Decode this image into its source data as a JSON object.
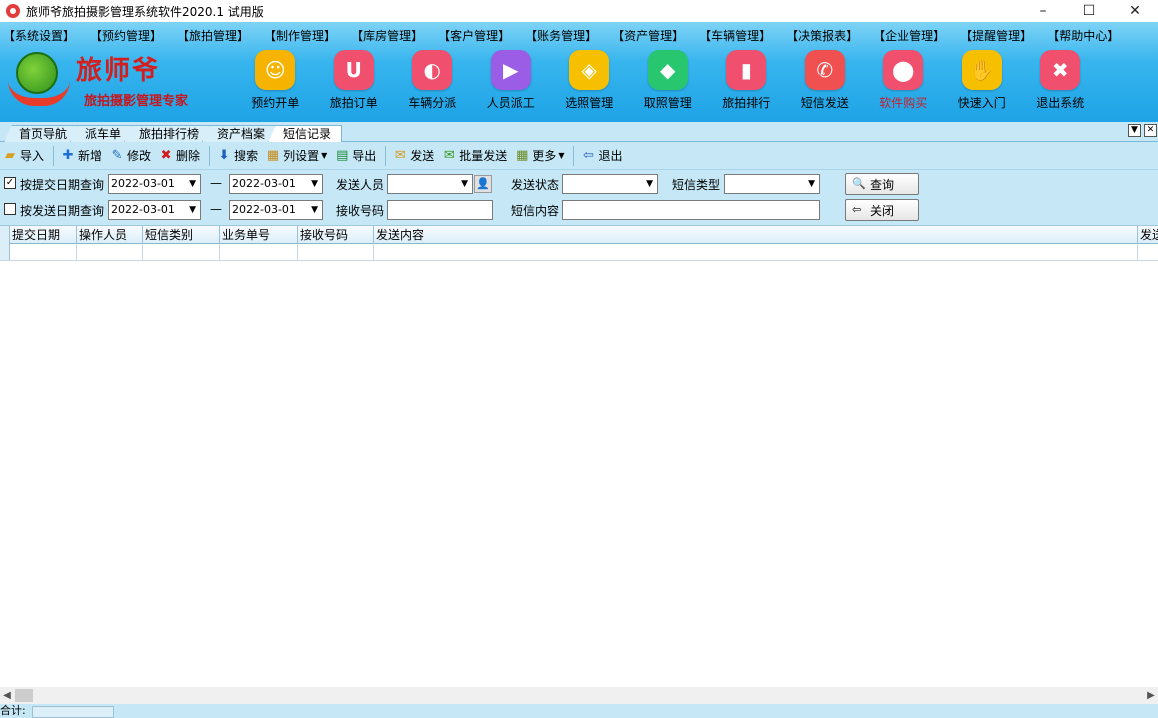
{
  "window": {
    "title": "旅师爷旅拍摄影管理系统软件2020.1 试用版",
    "controls": [
      "–",
      "☐",
      "✕"
    ]
  },
  "menu": [
    "【系统设置】",
    "【预约管理】",
    "【旅拍管理】",
    "【制作管理】",
    "【库房管理】",
    "【客户管理】",
    "【账务管理】",
    "【资产管理】",
    "【车辆管理】",
    "【决策报表】",
    "【企业管理】",
    "【提醒管理】",
    "【帮助中心】"
  ],
  "logo": {
    "title": "旅师爷",
    "subtitle": "旅拍摄影管理专家"
  },
  "nav": [
    {
      "label": "预约开单",
      "color": "#f6b400",
      "glyph": "☺",
      "icon": "calendar-icon"
    },
    {
      "label": "旅拍订单",
      "color": "#f0506e",
      "glyph": "U",
      "icon": "order-icon"
    },
    {
      "label": "车辆分派",
      "color": "#f0506e",
      "glyph": "◐",
      "icon": "car-icon"
    },
    {
      "label": "人员派工",
      "color": "#9b5de5",
      "glyph": "▶",
      "icon": "staff-icon"
    },
    {
      "label": "选照管理",
      "color": "#f6c000",
      "glyph": "◈",
      "icon": "photo-select-icon"
    },
    {
      "label": "取照管理",
      "color": "#28c76f",
      "glyph": "◆",
      "icon": "photo-pickup-icon"
    },
    {
      "label": "旅拍排行",
      "color": "#f0506e",
      "glyph": "▮",
      "icon": "ranking-icon"
    },
    {
      "label": "短信发送",
      "color": "#f05050",
      "glyph": "✆",
      "icon": "sms-icon"
    },
    {
      "label": "软件购买",
      "color": "#f0506e",
      "glyph": "⬤",
      "icon": "purchase-icon",
      "accent": true
    },
    {
      "label": "快速入门",
      "color": "#f6c000",
      "glyph": "✋",
      "icon": "quickstart-icon"
    },
    {
      "label": "退出系统",
      "color": "#f0506e",
      "glyph": "✖",
      "icon": "exit-icon"
    }
  ],
  "tabs": [
    "首页导航",
    "派车单",
    "旅拍排行榜",
    "资产档案",
    "短信记录"
  ],
  "active_tab": 4,
  "toolbar": {
    "import": "导入",
    "add": "新增",
    "edit": "修改",
    "delete": "删除",
    "search": "搜索",
    "columns": "列设置",
    "export": "导出",
    "send": "发送",
    "batch_send": "批量发送",
    "more": "更多",
    "quit": "退出"
  },
  "filters": {
    "by_submit_date": "按提交日期查询",
    "by_send_date": "按发送日期查询",
    "submit_checked": "✓",
    "date_from_1": "2022-03-01",
    "date_to_1": "2022-03-01",
    "date_from_2": "2022-03-01",
    "date_to_2": "2022-03-01",
    "dash": "—",
    "sender_label": "发送人员",
    "status_label": "发送状态",
    "type_label": "短信类型",
    "receiver_label": "接收号码",
    "content_label": "短信内容",
    "query_button": "查询",
    "close_button": "关闭"
  },
  "grid": {
    "columns": [
      "提交日期",
      "操作人员",
      "短信类别",
      "业务单号",
      "接收号码",
      "发送内容",
      "发送"
    ]
  },
  "status": {
    "total_label": "合计:"
  }
}
